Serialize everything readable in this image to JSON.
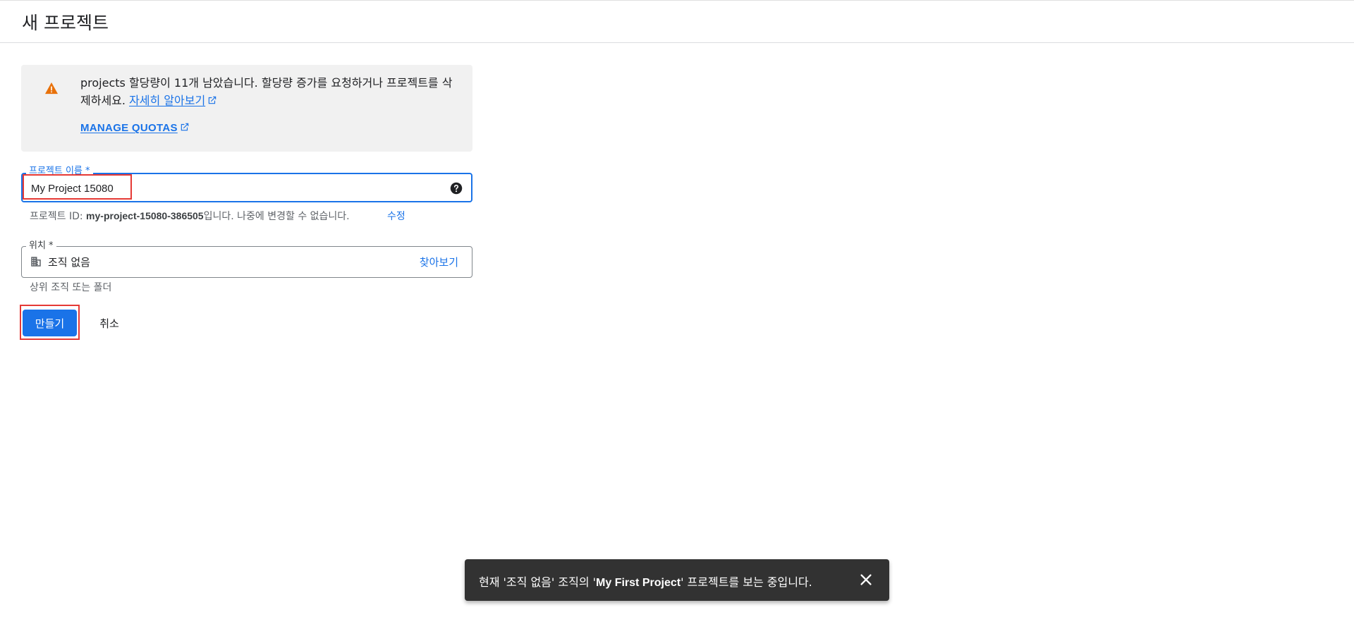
{
  "header": {
    "title": "새 프로젝트"
  },
  "quota": {
    "message": "projects 할당량이 11개 남았습니다. 할당량 증가를 요청하거나 프로젝트를 삭제하세요.",
    "learn_more": "자세히 알아보기",
    "manage_quotas": "MANAGE QUOTAS",
    "warning_icon": "warning-icon",
    "warning_color": "#e8710a"
  },
  "project_name": {
    "label": "프로젝트 이름 *",
    "value": "My Project 15080",
    "help_icon": "help-icon"
  },
  "project_id": {
    "prefix": "프로젝트 ID: ",
    "id": "my-project-15080-386505",
    "suffix": "입니다. 나중에 변경할 수 없습니다.",
    "edit": "수정"
  },
  "location": {
    "label": "위치 *",
    "value": "조직 없음",
    "browse": "찾아보기",
    "helper": "상위 조직 또는 폴더",
    "icon": "building-icon"
  },
  "actions": {
    "create": "만들기",
    "cancel": "취소"
  },
  "snackbar": {
    "prefix": "현재 '조직 없음' 조직의 '",
    "project": "My First Project",
    "suffix": "' 프로젝트를 보는 중입니다.",
    "close_icon": "close-icon"
  },
  "colors": {
    "accent": "#1a73e8",
    "highlight": "#e53935",
    "snackbar_bg": "#323232"
  }
}
